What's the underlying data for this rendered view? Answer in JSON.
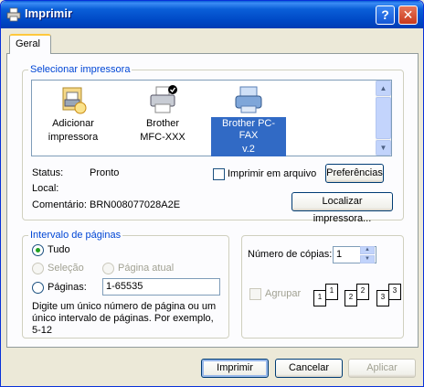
{
  "window": {
    "title": "Imprimir",
    "help_label": "?",
    "close_label": "✕"
  },
  "tabs": [
    {
      "label": "Geral"
    }
  ],
  "printer_group": {
    "label": "Selecionar impressora",
    "printers": [
      {
        "name_line1": "Adicionar",
        "name_line2": "impressora",
        "icon": "add-printer-icon",
        "selected": false
      },
      {
        "name_line1": "Brother",
        "name_line2": "MFC-XXX",
        "icon": "default-printer-icon",
        "selected": false
      },
      {
        "name_line1": "Brother PC-FAX",
        "name_line2": "v.2",
        "icon": "fax-printer-icon",
        "selected": true
      }
    ],
    "status_label": "Status:",
    "status_value": "Pronto",
    "local_label": "Local:",
    "local_value": "",
    "comment_label": "Comentário:",
    "comment_value": "BRN008077028A2E",
    "print_to_file_label": "Imprimir em arquivo",
    "print_to_file_checked": false,
    "preferences_label": "Preferências",
    "find_printer_label": "Localizar impressora..."
  },
  "page_range": {
    "label": "Intervalo de páginas",
    "all_label": "Tudo",
    "selection_label": "Seleção",
    "current_page_label": "Página atual",
    "pages_label": "Páginas:",
    "pages_value": "1-65535",
    "hint": [
      "Digite um único número de página ou um",
      "único intervalo de páginas. Por exemplo,",
      "5-12"
    ]
  },
  "copies": {
    "label": "Número de cópias:",
    "value": "1",
    "collate_label": "Agrupar",
    "pages": [
      "1",
      "1",
      "2",
      "2",
      "3",
      "3"
    ]
  },
  "footer": {
    "print_label": "Imprimir",
    "cancel_label": "Cancelar",
    "apply_label": "Aplicar"
  },
  "colors": {
    "accent": "#0046d5",
    "titlebar": "#0054e3",
    "selection": "#316ac5"
  }
}
